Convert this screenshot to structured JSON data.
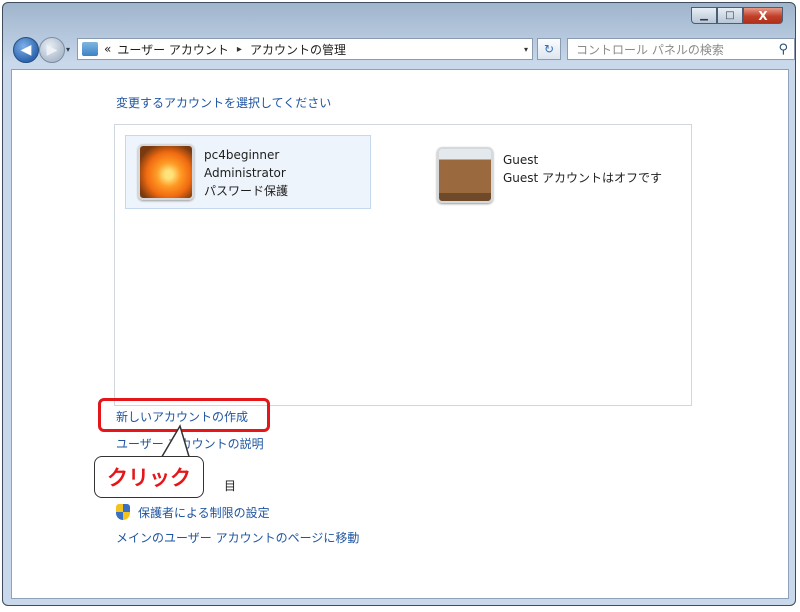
{
  "window": {
    "minimize_label": "▁",
    "maximize_label": "□",
    "close_label": "X"
  },
  "nav": {
    "back_label": "◀",
    "forward_label": "▶",
    "history_dropdown": "▾"
  },
  "address": {
    "prefix": "«",
    "crumb1": "ユーザー アカウント",
    "separator": "▸",
    "crumb2": "アカウントの管理",
    "dropdown": "▾",
    "refresh_label": "↻"
  },
  "search": {
    "placeholder": "コントロール パネルの検索",
    "icon": "search-icon"
  },
  "content": {
    "heading": "変更するアカウントを選択してください",
    "accounts": [
      {
        "name": "pc4beginner",
        "type": "Administrator",
        "status": "パスワード保護"
      },
      {
        "name": "Guest",
        "type": "Guest アカウントはオフです",
        "status": ""
      }
    ],
    "links": {
      "create": "新しいアカウントの作成",
      "explain": "ユーザー アカウントの説明",
      "section_partial": "目",
      "parental": "保護者による制限の設定",
      "main_page": "メインのユーザー アカウントのページに移動"
    }
  },
  "annotation": {
    "callout_text": "クリック",
    "color": "#e5161a"
  }
}
